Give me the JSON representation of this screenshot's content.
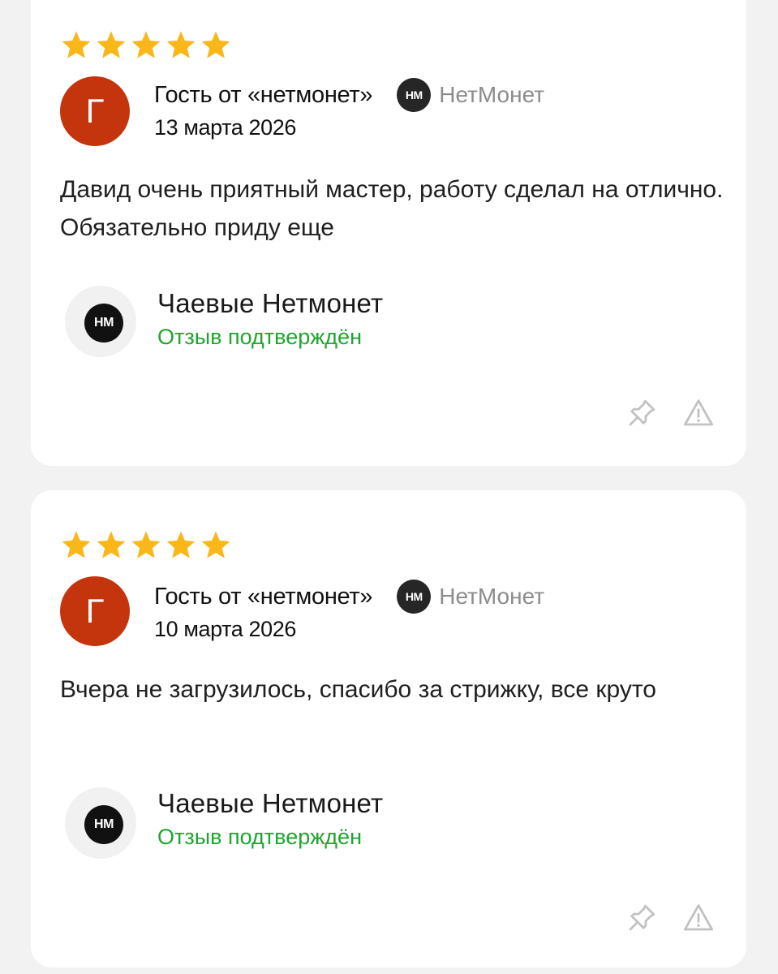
{
  "reviews": [
    {
      "rating": 5,
      "avatar_letter": "Г",
      "author": "Гость от «нетмонет»",
      "source_logo": "НМ",
      "source_name": "НетМонет",
      "date": "13 марта 2026",
      "text": "Давид очень приятный мастер, работу сделал на отлично. Обязательно приду еще",
      "org_logo": "НМ",
      "org_name": "Чаевые Нетмонет",
      "org_status": "Отзыв подтверждён"
    },
    {
      "rating": 5,
      "avatar_letter": "Г",
      "author": "Гость от «нетмонет»",
      "source_logo": "НМ",
      "source_name": "НетМонет",
      "date": "10 марта 2026",
      "text": "Вчера не загрузилось, спасибо за стрижку, все круто",
      "org_logo": "НМ",
      "org_name": "Чаевые Нетмонет",
      "org_status": "Отзыв подтверждён"
    }
  ],
  "colors": {
    "star": "#f9b71a",
    "avatar": "#c4350e",
    "status": "#1ea52e",
    "source_text": "#8c8c8c",
    "icon": "#c2c2c2"
  },
  "icons": {
    "star": "star-icon",
    "pin": "pin-icon",
    "report": "warning-icon"
  }
}
